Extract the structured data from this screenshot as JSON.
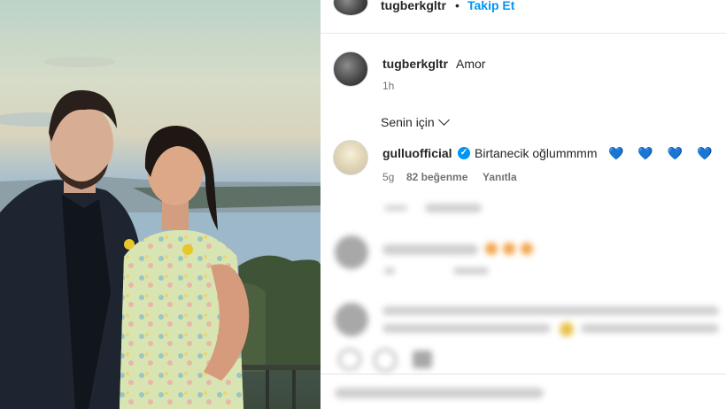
{
  "post": {
    "author": "tugberkgltr",
    "separator": "•",
    "follow_label": "Takip Et",
    "caption_text": "Amor",
    "caption_time": "1h"
  },
  "comments": {
    "sort_label": "Senin için",
    "top_comment": {
      "username": "gulluofficial",
      "verified": true,
      "text": "Birtanecik oğlummmm",
      "emoji": "💙 💙 💙 💙",
      "time": "5g",
      "likes": "82 beğenme",
      "reply_label": "Yanıtla"
    }
  },
  "colors": {
    "accent": "#0095f6",
    "heart": "#3897f0",
    "text": "#262626",
    "muted": "#737373"
  },
  "icons": {
    "chevron": "chevron-down-icon",
    "verified": "verified-badge-icon"
  }
}
